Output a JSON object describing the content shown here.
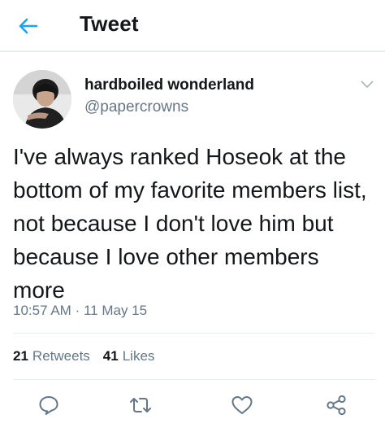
{
  "header": {
    "title": "Tweet",
    "back_icon": "arrow-left-icon"
  },
  "tweet": {
    "display_name": "hardboiled wonderland",
    "handle": "@papercrowns",
    "text": "I've always ranked Hoseok at the bottom of my favorite members list, not because I don't love him but because I love other members more",
    "time": "10:57 AM",
    "separator": "·",
    "date": "11 May 15",
    "retweets_count": "21",
    "retweets_label": "Retweets",
    "likes_count": "41",
    "likes_label": "Likes"
  },
  "actions": [
    "reply-icon",
    "retweet-icon",
    "like-icon",
    "share-icon"
  ],
  "colors": {
    "accent": "#1da1f2",
    "text": "#14171a",
    "secondary": "#657786",
    "divider": "#e6ecf0"
  }
}
